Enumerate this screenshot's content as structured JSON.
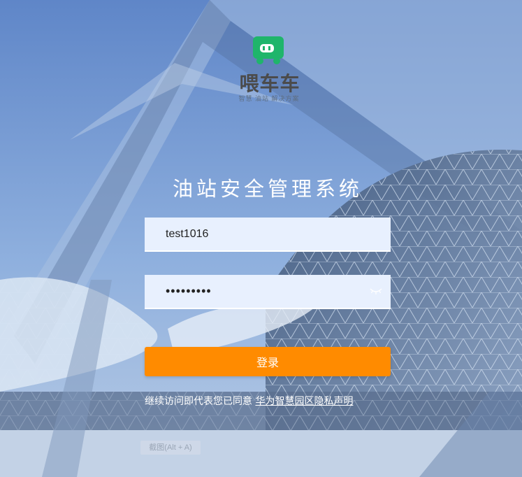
{
  "logo": {
    "name": "喂车车",
    "slogan": "智慧 油站 解决方案",
    "brand_color": "#1fb56b"
  },
  "title": "油站安全管理系统",
  "form": {
    "username_value": "test1016",
    "password_value": "test10160"
  },
  "login_button_label": "登录",
  "agreement": {
    "prefix": "继续访问即代表您已同意",
    "link": "华为智慧园区隐私声明"
  },
  "screenshot_hint": "截图(Alt + A)",
  "colors": {
    "accent": "#ff8b00",
    "input_bg": "#e8f0fe"
  },
  "icons": {
    "logo": "car-face-icon",
    "password_toggle": "eye-closed-icon"
  }
}
